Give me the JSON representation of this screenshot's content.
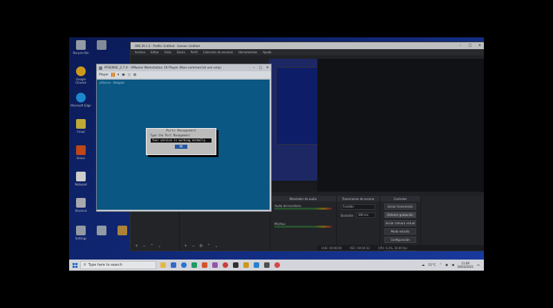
{
  "desktop": {
    "icons": [
      {
        "label": "Recycle Bin",
        "color": "#9aa3ad"
      },
      {
        "label": "Google Chrome",
        "color": "#d9a21c"
      },
      {
        "label": "Microsoft Edge",
        "color": "#1f8fd6"
      },
      {
        "label": "Fmod",
        "color": "#c9b23a"
      },
      {
        "label": "Brave",
        "color": "#c74b1d"
      },
      {
        "label": "Notepad",
        "color": "#d9d9d9"
      },
      {
        "label": "Shortcut",
        "color": "#b0b3b8"
      },
      {
        "label": "Settings",
        "color": "#9aa3ad"
      }
    ]
  },
  "obs": {
    "title": "OBS 29.1.3 - Profile: Untitled - Scenes: Untitled",
    "menu": [
      "Archivo",
      "Editar",
      "Vista",
      "Docks",
      "Perfil",
      "Colección de escenas",
      "Herramientas",
      "Ayuda"
    ],
    "mixer_header": "Mezclador de audio",
    "mixer_rows": [
      {
        "name": "Audio del escritorio",
        "level": "0.0 dB"
      },
      {
        "name": "Mic/Aux",
        "level": "0.0 dB"
      }
    ],
    "transitions_header": "Transiciones de escena",
    "transition_type": "Fundido",
    "duration_label": "Duración",
    "duration_value": "300 ms",
    "controls_header": "Controles",
    "controls": [
      {
        "label": "Iniciar transmisión",
        "active": false
      },
      {
        "label": "Detener grabación",
        "active": true
      },
      {
        "label": "Iniciar cámara virtual",
        "active": false
      },
      {
        "label": "Modo estudio",
        "active": false
      },
      {
        "label": "Configuración",
        "active": false
      },
      {
        "label": "Salir",
        "active": false
      }
    ],
    "status": [
      "LIVE: 00:00:00",
      "REC: 00:04:33",
      "CPU: 4.2%, 30.00 fps"
    ]
  },
  "vmware": {
    "title": "PFSENSE_2.7.0 - VMware Workstation 16 Player (Non-commercial use only)",
    "player_menu": "Player",
    "console_line": "pfSense - Netgate",
    "dialog": {
      "title": "Ports Management",
      "subtitle": "Type the Port Management",
      "message": "Your service is working normally",
      "ok_label": "OK"
    }
  },
  "taskbar": {
    "search_placeholder": "Type here to search",
    "weather": "11°C",
    "time": "11:09",
    "date": "26/03/2023",
    "apps": [
      "#f2c24a",
      "#3c6fcf",
      "#2a7be0",
      "#1fa36a",
      "#e3562f",
      "#9b59b6",
      "#d94141",
      "#333333",
      "#d6a21b",
      "#2b87d8",
      "#555555",
      "#e34b4b"
    ]
  }
}
